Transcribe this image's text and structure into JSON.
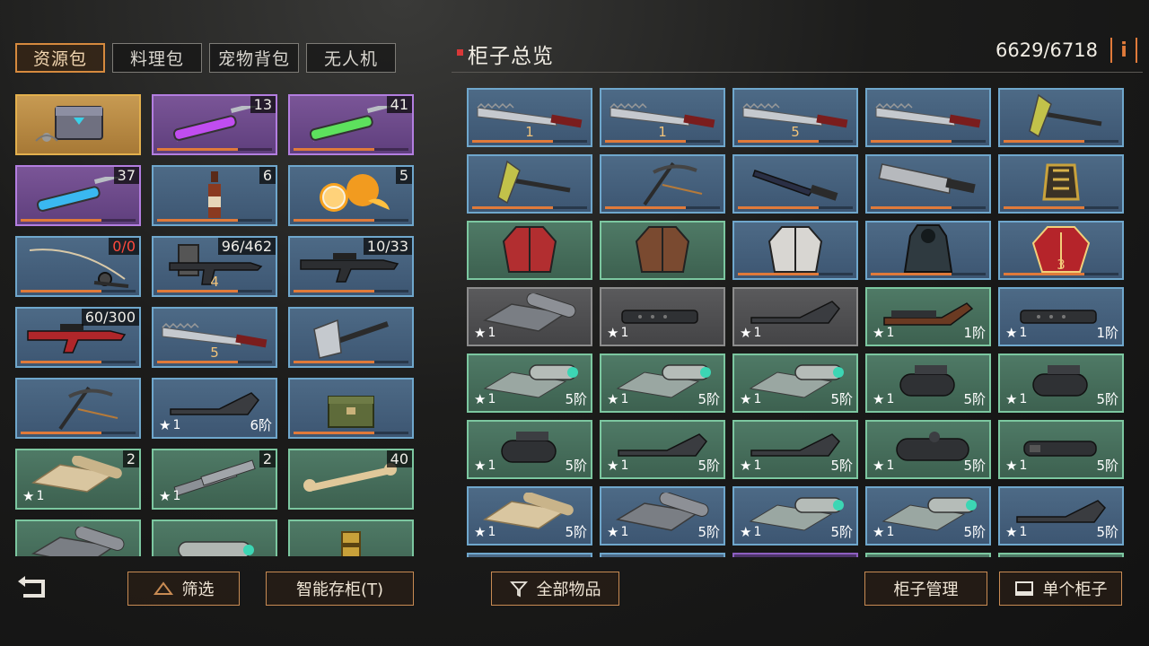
{
  "tabs": [
    {
      "label": "资源包",
      "active": true
    },
    {
      "label": "料理包",
      "active": false
    },
    {
      "label": "宠物背包",
      "active": false
    },
    {
      "label": "无人机",
      "active": false
    }
  ],
  "cabinet": {
    "title": "柜子总览",
    "capacity": "6629/6718",
    "info_label": "i"
  },
  "buttons": {
    "filter": "筛选",
    "smart_store": "智能存柜(T)",
    "all_items": "全部物品",
    "cabinet_manage": "柜子管理",
    "single_cabinet": "单个柜子"
  },
  "left_items": [
    {
      "name": "supply-chest",
      "rarity": "gold",
      "count": "",
      "star": "",
      "tier": ""
    },
    {
      "name": "purple-syringe",
      "rarity": "purple",
      "count": "13",
      "star": "",
      "tier": ""
    },
    {
      "name": "green-syringe",
      "rarity": "purple",
      "count": "41",
      "star": "",
      "tier": ""
    },
    {
      "name": "blue-syringe",
      "rarity": "purple",
      "count": "37",
      "star": "",
      "tier": ""
    },
    {
      "name": "bottle",
      "rarity": "blue",
      "count": "6",
      "star": "",
      "tier": ""
    },
    {
      "name": "orange",
      "rarity": "blue",
      "count": "5",
      "star": "",
      "tier": ""
    },
    {
      "name": "fishing-rod",
      "rarity": "blue",
      "count": "0/0",
      "count_red": true,
      "star": "",
      "tier": ""
    },
    {
      "name": "shield-rifle",
      "rarity": "blue",
      "count": "96/462",
      "star": "",
      "tier": "",
      "stars": "4"
    },
    {
      "name": "sniper-rifle",
      "rarity": "blue",
      "count": "10/33",
      "star": "",
      "tier": ""
    },
    {
      "name": "red-rifle",
      "rarity": "blue",
      "count": "60/300",
      "star": "",
      "tier": ""
    },
    {
      "name": "saw-blade",
      "rarity": "blue",
      "count": "",
      "star": "",
      "tier": "",
      "stars": "5"
    },
    {
      "name": "axe",
      "rarity": "blue",
      "count": "",
      "star": "",
      "tier": ""
    },
    {
      "name": "pickaxe",
      "rarity": "blue",
      "count": "",
      "star": "",
      "tier": ""
    },
    {
      "name": "stock",
      "rarity": "blue",
      "count": "",
      "star": "1",
      "tier": "6阶"
    },
    {
      "name": "ammo-box",
      "rarity": "blue",
      "count": "",
      "star": "",
      "tier": ""
    },
    {
      "name": "cloth-roll",
      "rarity": "green",
      "count": "2",
      "star": "1",
      "tier": ""
    },
    {
      "name": "pipes",
      "rarity": "green",
      "count": "2",
      "star": "1",
      "tier": ""
    },
    {
      "name": "bone",
      "rarity": "green",
      "count": "40",
      "star": "",
      "tier": ""
    },
    {
      "name": "mesh-roll",
      "rarity": "green",
      "count": "",
      "star": "",
      "tier": ""
    },
    {
      "name": "silencer",
      "rarity": "green",
      "count": "",
      "star": "",
      "tier": ""
    },
    {
      "name": "golden-canister",
      "rarity": "green",
      "count": "",
      "star": "",
      "tier": ""
    }
  ],
  "right_items": [
    {
      "name": "saw-blade",
      "rarity": "blue",
      "star": "",
      "tier": "",
      "stars": "1"
    },
    {
      "name": "saw-blade",
      "rarity": "blue",
      "star": "",
      "tier": "",
      "stars": "1"
    },
    {
      "name": "saw-blade",
      "rarity": "blue",
      "star": "",
      "tier": "",
      "stars": "5"
    },
    {
      "name": "saw-blade",
      "rarity": "blue",
      "star": "",
      "tier": "",
      "stars": ""
    },
    {
      "name": "hatchet",
      "rarity": "blue",
      "star": "",
      "tier": "",
      "stars": ""
    },
    {
      "name": "hatchet",
      "rarity": "blue",
      "star": "",
      "tier": "",
      "stars": ""
    },
    {
      "name": "pickaxe",
      "rarity": "blue",
      "star": "",
      "tier": "",
      "stars": ""
    },
    {
      "name": "combat-knife",
      "rarity": "blue",
      "star": "",
      "tier": "",
      "stars": ""
    },
    {
      "name": "chainsaw",
      "rarity": "blue",
      "star": "",
      "tier": "",
      "stars": ""
    },
    {
      "name": "golden-vest",
      "rarity": "blue",
      "star": "",
      "tier": "",
      "stars": ""
    },
    {
      "name": "red-jacket",
      "rarity": "green",
      "star": "",
      "tier": "",
      "stars": ""
    },
    {
      "name": "brown-jacket",
      "rarity": "green",
      "star": "",
      "tier": "",
      "stars": ""
    },
    {
      "name": "white-jacket",
      "rarity": "blue",
      "star": "",
      "tier": "",
      "stars": ""
    },
    {
      "name": "hooded-coat",
      "rarity": "blue",
      "star": "",
      "tier": "",
      "stars": ""
    },
    {
      "name": "red-armor",
      "rarity": "blue",
      "star": "",
      "tier": "",
      "stars": "3"
    },
    {
      "name": "mesh-roll",
      "rarity": "gray",
      "star": "1",
      "tier": "",
      "stars": ""
    },
    {
      "name": "barrel",
      "rarity": "gray",
      "star": "1",
      "tier": "",
      "stars": ""
    },
    {
      "name": "stock",
      "rarity": "gray",
      "star": "1",
      "tier": "",
      "stars": ""
    },
    {
      "name": "handguard",
      "rarity": "green",
      "star": "1",
      "tier": "1阶",
      "stars": ""
    },
    {
      "name": "barrel",
      "rarity": "blue",
      "star": "1",
      "tier": "1阶",
      "stars": ""
    },
    {
      "name": "silencer-roll",
      "rarity": "green",
      "star": "1",
      "tier": "5阶",
      "stars": ""
    },
    {
      "name": "silencer-roll",
      "rarity": "green",
      "star": "1",
      "tier": "5阶",
      "stars": ""
    },
    {
      "name": "silencer-roll",
      "rarity": "green",
      "star": "1",
      "tier": "5阶",
      "stars": ""
    },
    {
      "name": "scope",
      "rarity": "green",
      "star": "1",
      "tier": "5阶",
      "stars": ""
    },
    {
      "name": "scope",
      "rarity": "green",
      "star": "1",
      "tier": "5阶",
      "stars": ""
    },
    {
      "name": "scope",
      "rarity": "green",
      "star": "1",
      "tier": "5阶",
      "stars": ""
    },
    {
      "name": "stock",
      "rarity": "green",
      "star": "1",
      "tier": "5阶",
      "stars": ""
    },
    {
      "name": "stock",
      "rarity": "green",
      "star": "1",
      "tier": "5阶",
      "stars": ""
    },
    {
      "name": "tube-scope",
      "rarity": "green",
      "star": "1",
      "tier": "5阶",
      "stars": ""
    },
    {
      "name": "muzzle",
      "rarity": "green",
      "star": "1",
      "tier": "5阶",
      "stars": ""
    },
    {
      "name": "cloth-roll",
      "rarity": "blue",
      "star": "1",
      "tier": "5阶",
      "stars": ""
    },
    {
      "name": "mesh-roll",
      "rarity": "blue",
      "star": "1",
      "tier": "5阶",
      "stars": ""
    },
    {
      "name": "silencer-roll",
      "rarity": "blue",
      "star": "1",
      "tier": "5阶",
      "stars": ""
    },
    {
      "name": "silencer-roll",
      "rarity": "blue",
      "star": "1",
      "tier": "5阶",
      "stars": ""
    },
    {
      "name": "stock",
      "rarity": "blue",
      "star": "1",
      "tier": "5阶",
      "stars": ""
    },
    {
      "name": "partial-item",
      "rarity": "blue",
      "star": "",
      "tier": "",
      "stars": ""
    },
    {
      "name": "partial-item",
      "rarity": "blue",
      "star": "",
      "tier": "",
      "stars": ""
    },
    {
      "name": "partial-item",
      "rarity": "darkpurple",
      "star": "",
      "tier": "",
      "stars": ""
    },
    {
      "name": "partial-item",
      "rarity": "green",
      "star": "",
      "tier": "",
      "stars": ""
    },
    {
      "name": "partial-item",
      "rarity": "green",
      "star": "",
      "tier": "",
      "stars": ""
    }
  ]
}
